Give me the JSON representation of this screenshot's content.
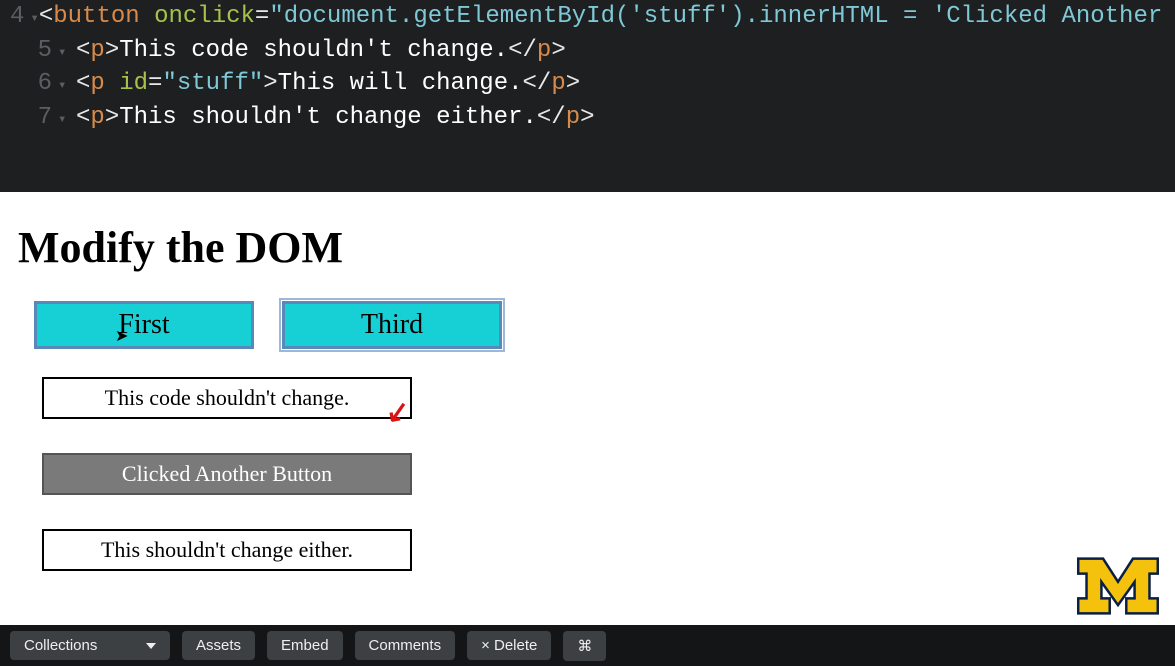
{
  "editor": {
    "lines": [
      {
        "num": "4",
        "tokens": [
          {
            "t": "<",
            "c": "tok-punct"
          },
          {
            "t": "button",
            "c": "tok-tag"
          },
          {
            "t": " ",
            "c": "tok-text"
          },
          {
            "t": "onclick",
            "c": "tok-attr"
          },
          {
            "t": "=",
            "c": "tok-punct"
          },
          {
            "t": "\"document.getElementById('stuff').innerHTML = 'Clicked Another But",
            "c": "tok-str"
          }
        ]
      },
      {
        "num": "5",
        "tokens": [
          {
            "t": "<",
            "c": "tok-punct"
          },
          {
            "t": "p",
            "c": "tok-tag"
          },
          {
            "t": ">",
            "c": "tok-punct"
          },
          {
            "t": "This code shouldn't change.",
            "c": "tok-text"
          },
          {
            "t": "</",
            "c": "tok-punct"
          },
          {
            "t": "p",
            "c": "tok-tag"
          },
          {
            "t": ">",
            "c": "tok-punct"
          }
        ]
      },
      {
        "num": "6",
        "tokens": [
          {
            "t": "<",
            "c": "tok-punct"
          },
          {
            "t": "p",
            "c": "tok-tag"
          },
          {
            "t": " ",
            "c": "tok-text"
          },
          {
            "t": "id",
            "c": "tok-attr"
          },
          {
            "t": "=",
            "c": "tok-punct"
          },
          {
            "t": "\"stuff\"",
            "c": "tok-str"
          },
          {
            "t": ">",
            "c": "tok-punct"
          },
          {
            "t": "This will change.",
            "c": "tok-text"
          },
          {
            "t": "</",
            "c": "tok-punct"
          },
          {
            "t": "p",
            "c": "tok-tag"
          },
          {
            "t": ">",
            "c": "tok-punct"
          }
        ]
      },
      {
        "num": "7",
        "tokens": [
          {
            "t": "<",
            "c": "tok-punct"
          },
          {
            "t": "p",
            "c": "tok-tag"
          },
          {
            "t": ">",
            "c": "tok-punct"
          },
          {
            "t": "This shouldn't change either.",
            "c": "tok-text"
          },
          {
            "t": "</",
            "c": "tok-punct"
          },
          {
            "t": "p",
            "c": "tok-tag"
          },
          {
            "t": ">",
            "c": "tok-punct"
          }
        ]
      }
    ]
  },
  "preview": {
    "heading": "Modify the DOM",
    "buttons": {
      "first": "First",
      "third": "Third"
    },
    "paragraphs": {
      "p1": "This code shouldn't change.",
      "p2": "Clicked Another Button",
      "p3": "This shouldn't change either."
    }
  },
  "toolbar": {
    "collections": "Collections",
    "assets": "Assets",
    "embed": "Embed",
    "comments": "Comments",
    "delete": "× Delete",
    "shortcut": "⌘"
  },
  "colors": {
    "button_bg": "#17d0d6",
    "logo_yellow": "#f4c20d",
    "annotation_red": "#d81414"
  }
}
